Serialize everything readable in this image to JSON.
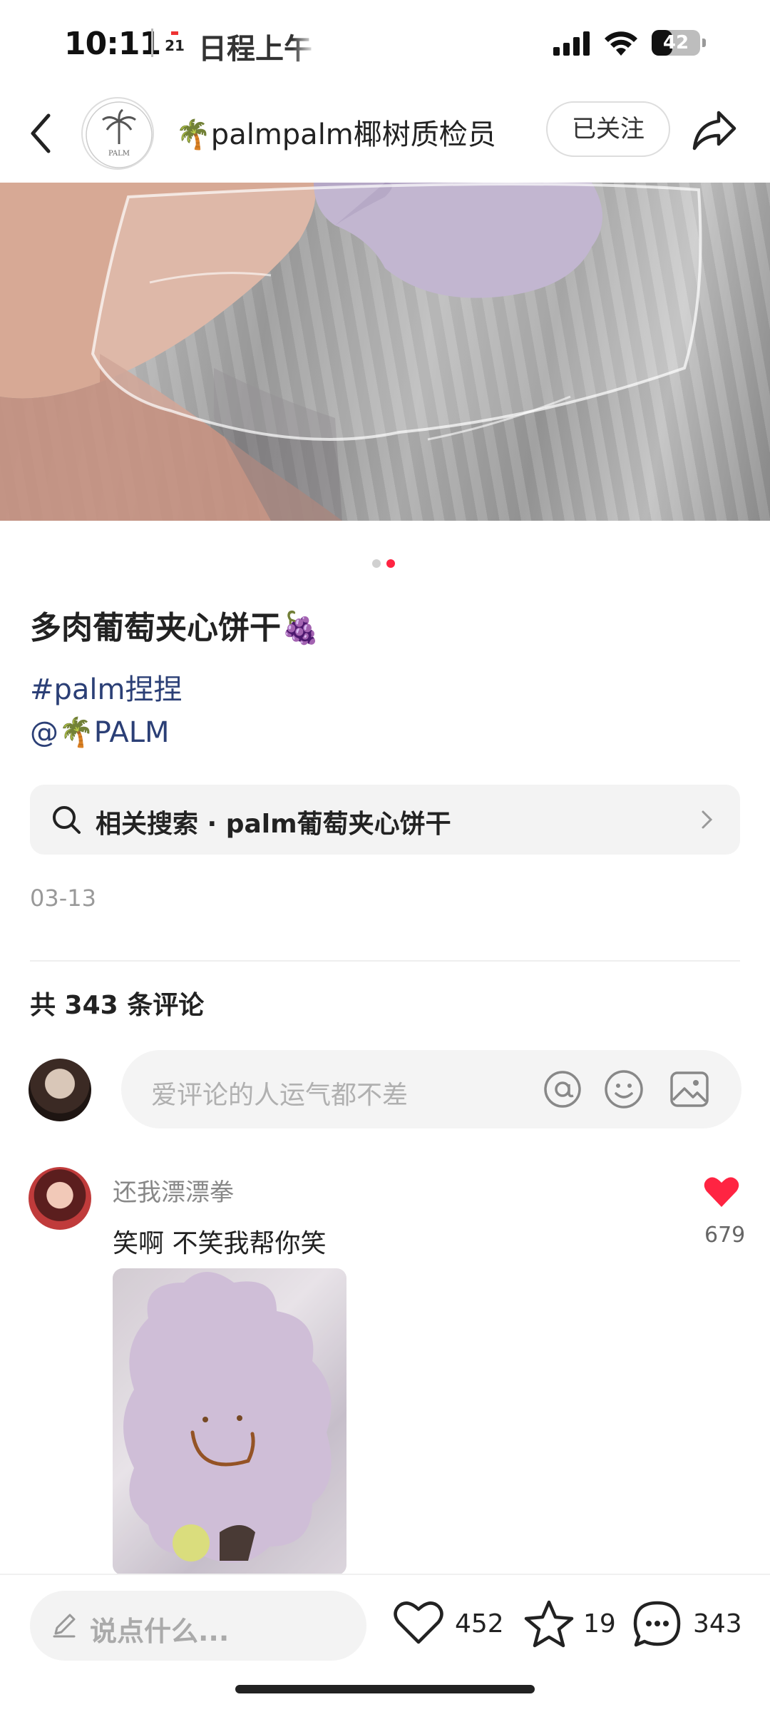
{
  "status_bar": {
    "time": "10:11",
    "calendar_day": "21",
    "app_label": "日程上午",
    "battery": "42",
    "battery_level": 0.42
  },
  "header": {
    "author_name": "🌴palmpalm椰树质检员",
    "follow_label": "已关注",
    "logo_text": "PALM"
  },
  "media": {
    "page_count": 2,
    "active_page": 2
  },
  "post": {
    "title": "多肉葡萄夹心饼干🍇",
    "hashtag": "#palm捏捏",
    "mention": "@🌴PALM",
    "related_search": "相关搜索 · palm葡萄夹心饼干",
    "date": "03-13"
  },
  "comments": {
    "count_label": "共 343 条评论",
    "input_placeholder": "爱评论的人运气都不差",
    "items": [
      {
        "user": "还我漂漂拳",
        "text": "笑啊 不笑我帮你笑",
        "likes": "679"
      }
    ]
  },
  "bottom_bar": {
    "say_placeholder": "说点什么...",
    "likes": "452",
    "collects": "19",
    "comments": "343"
  },
  "colors": {
    "accent_red": "#ff2442",
    "link_blue": "#2b3f76",
    "text_dark": "#222222",
    "text_muted": "#999999"
  }
}
